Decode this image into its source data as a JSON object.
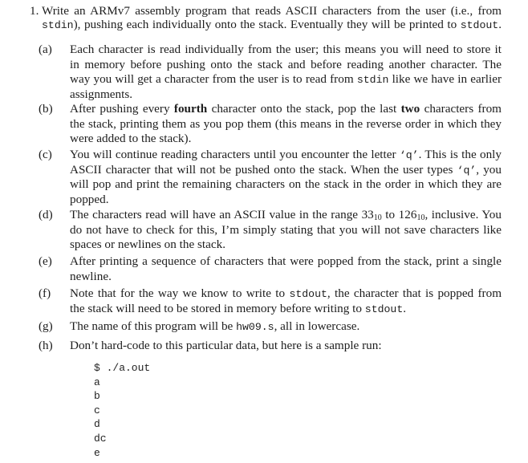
{
  "question": {
    "number": "1.",
    "intro_lines": [
      [
        "Write an ARMv7 assembly program that reads ASCII characters from the user (i.e., from"
      ],
      [
        "",
        "stdin",
        "), pushing each individually onto the stack. Eventually they will be printed to ",
        "stdout",
        "."
      ]
    ],
    "items": [
      {
        "label": "(a)",
        "lines": [
          "Each character is read individually from the user; this means you will need to store it",
          "in memory before pushing onto the stack and before reading another character.  The",
          "way you will get a character from the user is to read from |stdin| like we have in earlier",
          "assignments."
        ]
      },
      {
        "label": "(b)",
        "lines": [
          "After pushing every *fourth* character onto the stack, pop the last *two* characters from",
          "the stack, printing them as you pop them (this means in the reverse order in which they",
          "were added to the stack)."
        ]
      },
      {
        "label": "(c)",
        "lines": [
          "You will continue reading characters until you encounter the letter |‘q’|. This is the only",
          "ASCII character that will not be pushed onto the stack. When the user types |‘q’|, you",
          "will pop and print the remaining characters on the stack in the order in which they are",
          "popped."
        ]
      },
      {
        "label": "(d)",
        "lines": [
          "The characters read will have an ASCII value in the range 33_10 to 126_10, inclusive. You",
          "do not have to check for this, I’m simply stating that you will not save characters like",
          "spaces or newlines on the stack."
        ]
      },
      {
        "label": "(e)",
        "lines": [
          "After printing a sequence of characters that were popped from the stack, print a single",
          "newline."
        ]
      },
      {
        "label": "(f)",
        "lines": [
          "Note that for the way we know to write to |stdout|, the character that is popped from",
          "the stack will need to be stored in memory before writing to |stdout|."
        ]
      },
      {
        "label": "(g)",
        "lines": [
          "The name of this program will be |hw09.s|, all in lowercase."
        ]
      },
      {
        "label": "(h)",
        "lines": [
          "Don’t hard-code to this particular data, but here is a sample run:"
        ]
      }
    ],
    "sample_run": [
      "$ ./a.out",
      "a",
      "b",
      "c",
      "d",
      "dc",
      "e"
    ]
  }
}
